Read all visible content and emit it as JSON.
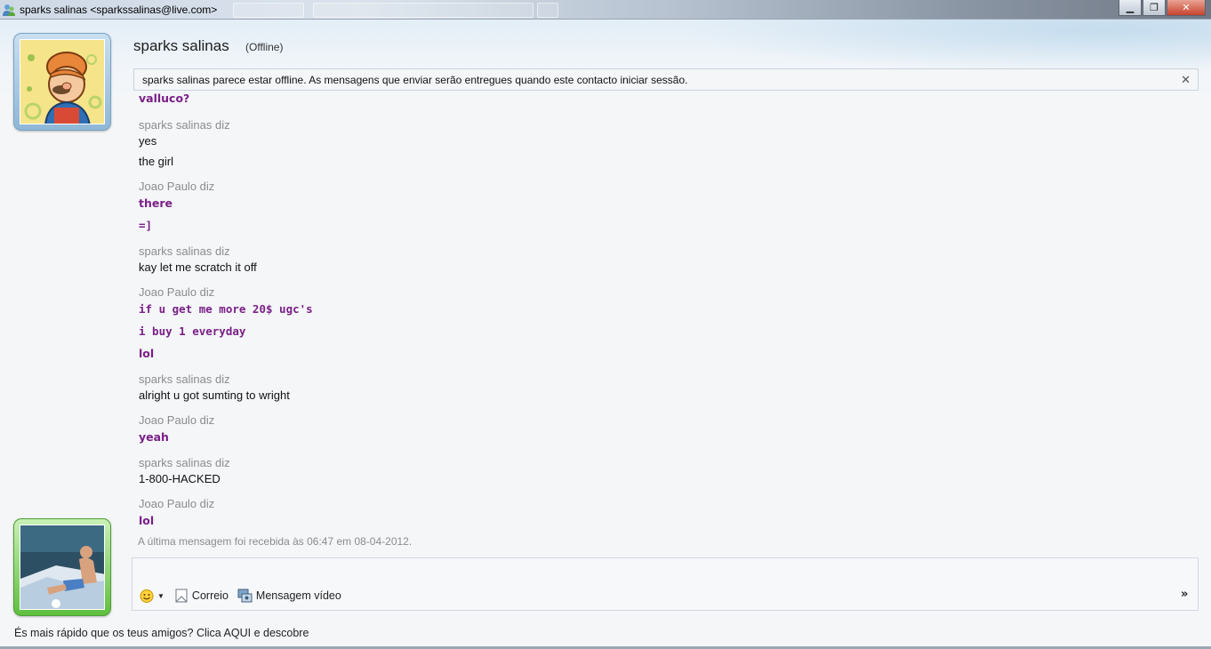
{
  "window": {
    "title": "sparks salinas <sparkssalinas@live.com>",
    "minimize_glyph": "▁",
    "restore_glyph": "❐",
    "close_glyph": "✕"
  },
  "contact": {
    "name": "sparks salinas",
    "status": "(Offline)"
  },
  "infobar": {
    "text": "sparks salinas parece estar offline. As mensagens que enviar serão entregues quando este contacto iniciar sessão.",
    "close_glyph": "✕"
  },
  "messages": [
    {
      "type": "line",
      "sender": "me",
      "text": "valluco?"
    },
    {
      "type": "author",
      "text": "sparks salinas diz"
    },
    {
      "type": "line",
      "sender": "them",
      "text": "yes"
    },
    {
      "type": "line",
      "sender": "them",
      "text": "the girl"
    },
    {
      "type": "author",
      "text": "Joao Paulo diz"
    },
    {
      "type": "line",
      "sender": "me",
      "text": "there"
    },
    {
      "type": "line",
      "sender": "me",
      "text": "=]"
    },
    {
      "type": "author",
      "text": "sparks salinas diz"
    },
    {
      "type": "line",
      "sender": "them",
      "text": "kay let me scratch it off"
    },
    {
      "type": "author",
      "text": "Joao Paulo diz"
    },
    {
      "type": "line",
      "sender": "me",
      "text": "if u get me more 20$ ugc's"
    },
    {
      "type": "line",
      "sender": "me",
      "text": "i buy 1 everyday"
    },
    {
      "type": "line",
      "sender": "me",
      "text": "lol"
    },
    {
      "type": "author",
      "text": "sparks salinas diz"
    },
    {
      "type": "line",
      "sender": "them",
      "text": "alright u got sumting to wright"
    },
    {
      "type": "author",
      "text": "Joao Paulo diz"
    },
    {
      "type": "line",
      "sender": "me",
      "text": "yeah"
    },
    {
      "type": "author",
      "text": "sparks salinas diz"
    },
    {
      "type": "line",
      "sender": "them",
      "text": "1-800-HACKED"
    },
    {
      "type": "author",
      "text": "Joao Paulo diz"
    },
    {
      "type": "line",
      "sender": "me",
      "text": "lol"
    }
  ],
  "last_message": "A última mensagem foi recebida às 06:47 em 08-04-2012.",
  "toolbar": {
    "emoticon_icon": "smiley-icon",
    "mail_label": "Correio",
    "video_label": "Mensagem vídeo",
    "more_glyph": "»"
  },
  "footer": {
    "ad_text": "És mais rápido que os teus amigos? Clica AQUI e descobre"
  },
  "colors": {
    "my_text": "#7a1f87",
    "author_text": "#8c8c8c"
  }
}
